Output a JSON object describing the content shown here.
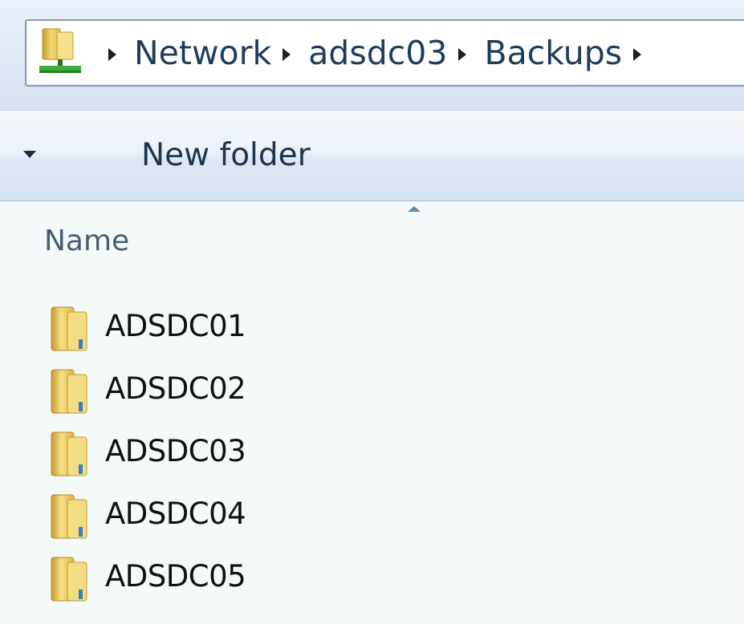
{
  "address_bar": {
    "location_icon": "network-location-icon",
    "breadcrumbs": [
      {
        "label": "Network"
      },
      {
        "label": "adsdc03"
      },
      {
        "label": "Backups"
      }
    ],
    "separator_icon": "chevron-right-icon"
  },
  "command_bar": {
    "organize_icon": "chevron-down-icon",
    "new_folder_label": "New folder"
  },
  "file_list": {
    "sort_icon": "sort-ascending-icon",
    "columns": [
      {
        "label": "Name"
      }
    ],
    "items": [
      {
        "name": "ADSDC01",
        "icon": "folder-icon"
      },
      {
        "name": "ADSDC02",
        "icon": "folder-icon"
      },
      {
        "name": "ADSDC03",
        "icon": "folder-icon"
      },
      {
        "name": "ADSDC04",
        "icon": "folder-icon"
      },
      {
        "name": "ADSDC05",
        "icon": "folder-icon"
      }
    ]
  },
  "colors": {
    "accent_text": "#1e3c5c",
    "folder_yellow": "#e8c45a",
    "list_background": "#f4f9fa"
  }
}
